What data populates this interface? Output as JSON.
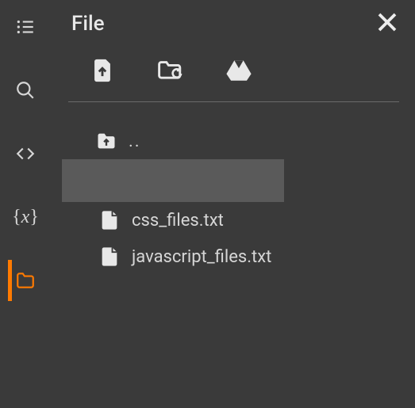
{
  "panel": {
    "title": "File"
  },
  "toolbar": {
    "upload_tooltip": "Upload file",
    "refresh_tooltip": "Refresh folder",
    "drive_tooltip": "Google Drive"
  },
  "tree": {
    "up_label": "..",
    "selected_label": "",
    "files": [
      {
        "name": "css_files.txt"
      },
      {
        "name": "javascript_files.txt"
      }
    ]
  },
  "sidebar": {
    "toc_label": "Contents",
    "search_label": "Search",
    "code_label": "Snippets",
    "vars_label": "Variables",
    "files_label": "Files"
  }
}
